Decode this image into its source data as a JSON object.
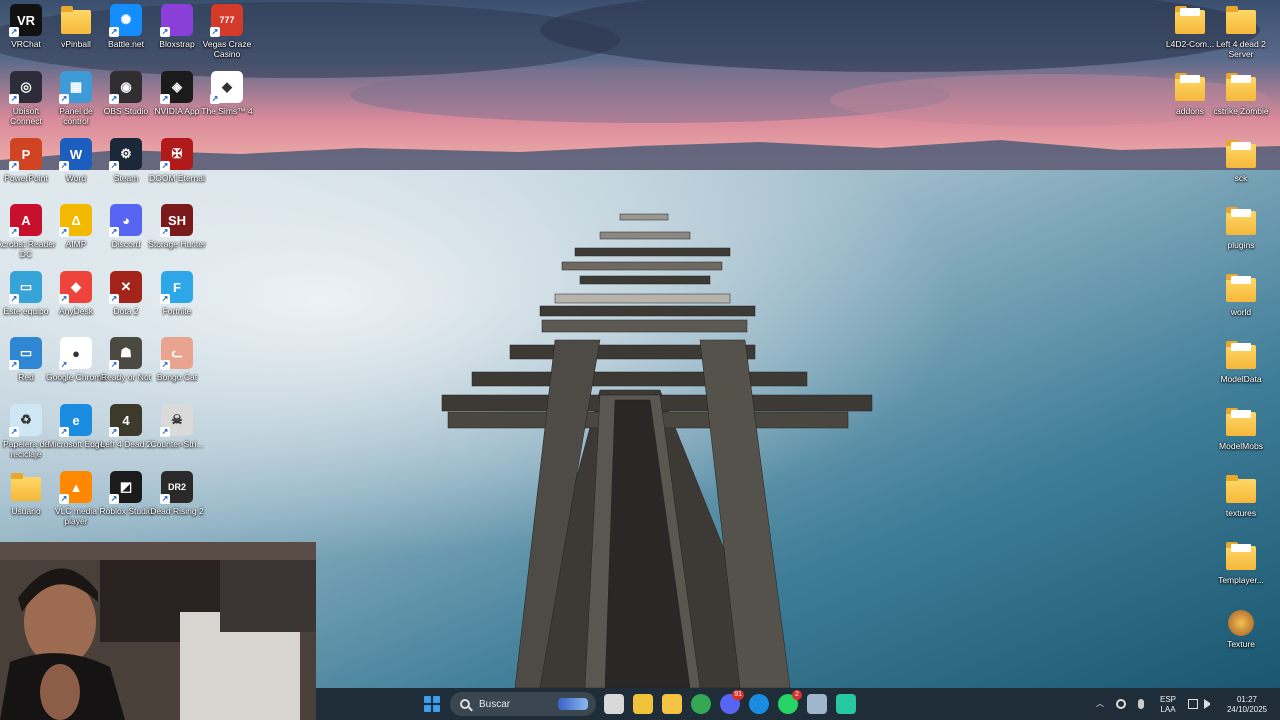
{
  "desktop": {
    "left_icons": [
      {
        "label": "VRChat",
        "icon": "vrchat-icon",
        "color": "#111111",
        "glyph": "VR"
      },
      {
        "label": "vPinball",
        "icon": "folder-icon",
        "color": "#f5c445",
        "glyph": ""
      },
      {
        "label": "Battle.net",
        "icon": "battlenet-icon",
        "color": "#148eff",
        "glyph": "✺"
      },
      {
        "label": "Bloxstrap",
        "icon": "bloxstrap-icon",
        "color": "#8b3fd9",
        "glyph": ""
      },
      {
        "label": "Vegas Craze Casino",
        "icon": "vegas-craze-icon",
        "color": "#d43a2a",
        "glyph": "777"
      },
      {
        "label": "Ubisoft Connect",
        "icon": "ubisoft-icon",
        "color": "#2c2c3a",
        "glyph": "◎"
      },
      {
        "label": "Panel de control",
        "icon": "control-panel-icon",
        "color": "#3f9ad8",
        "glyph": "▦"
      },
      {
        "label": "OBS Studio",
        "icon": "obs-icon",
        "color": "#302e31",
        "glyph": "◉"
      },
      {
        "label": "NVIDIA App",
        "icon": "nvidia-icon",
        "color": "#1b1b1b",
        "glyph": "◈"
      },
      {
        "label": "The Sims™ 4",
        "icon": "sims-icon",
        "color": "#ffffff",
        "glyph": "◆"
      },
      {
        "label": "PowerPoint",
        "icon": "powerpoint-icon",
        "color": "#d04423",
        "glyph": "P"
      },
      {
        "label": "Word",
        "icon": "word-icon",
        "color": "#1b5ebe",
        "glyph": "W"
      },
      {
        "label": "Steam",
        "icon": "steam-icon",
        "color": "#1b2838",
        "glyph": "⚙"
      },
      {
        "label": "DOOM Eternal",
        "icon": "doom-icon",
        "color": "#b01a1a",
        "glyph": "✠"
      },
      {
        "label": "Acrobat Reader DC",
        "icon": "acrobat-icon",
        "color": "#c8102e",
        "glyph": "A"
      },
      {
        "label": "AIMP",
        "icon": "aimp-icon",
        "color": "#f2b900",
        "glyph": "Δ"
      },
      {
        "label": "Discord",
        "icon": "discord-icon",
        "color": "#5865f2",
        "glyph": "◕"
      },
      {
        "label": "Storage Hunter",
        "icon": "storage-hunter-icon",
        "color": "#7a1a1a",
        "glyph": "SH"
      },
      {
        "label": "Este equipo",
        "icon": "this-pc-icon",
        "color": "#36a3d9",
        "glyph": "▭"
      },
      {
        "label": "AnyDesk",
        "icon": "anydesk-icon",
        "color": "#ef443b",
        "glyph": "◆"
      },
      {
        "label": "Dota 2",
        "icon": "dota2-icon",
        "color": "#a3241b",
        "glyph": "✕"
      },
      {
        "label": "Fortnite",
        "icon": "fortnite-icon",
        "color": "#2ea7e8",
        "glyph": "F"
      },
      {
        "label": "Red",
        "icon": "network-icon",
        "color": "#2f86d2",
        "glyph": "▭"
      },
      {
        "label": "Google Chrome",
        "icon": "chrome-icon",
        "color": "#ffffff",
        "glyph": "●"
      },
      {
        "label": "Ready or Not",
        "icon": "ready-or-not-icon",
        "color": "#4a4a42",
        "glyph": "☗"
      },
      {
        "label": "Bongo Cat",
        "icon": "bongo-cat-icon",
        "color": "#e9a48f",
        "glyph": "ᓚ"
      },
      {
        "label": "Papelera de reciclaje",
        "icon": "recycle-bin-icon",
        "color": "#cfe7f5",
        "glyph": "♻"
      },
      {
        "label": "Microsoft Edge",
        "icon": "edge-icon",
        "color": "#1a8de0",
        "glyph": "e"
      },
      {
        "label": "Left 4 Dead 2",
        "icon": "left4dead2-icon",
        "color": "#3b3a2b",
        "glyph": "4"
      },
      {
        "label": "Counter-Stri...",
        "icon": "counter-strike-icon",
        "color": "#dadada",
        "glyph": "☠"
      },
      {
        "label": "Usuario",
        "icon": "folder-icon",
        "color": "#f5c445",
        "glyph": ""
      },
      {
        "label": "VLC media player",
        "icon": "vlc-icon",
        "color": "#ff8800",
        "glyph": "▲"
      },
      {
        "label": "Roblox Studio",
        "icon": "roblox-studio-icon",
        "color": "#1b1b1b",
        "glyph": "◩"
      },
      {
        "label": "Dead Rising 2",
        "icon": "dead-rising2-icon",
        "color": "#2a2a2a",
        "glyph": "DR2"
      }
    ],
    "right_icons": [
      {
        "label": "L4D2-Com...",
        "icon": "folder-icon"
      },
      {
        "label": "Left 4 dead 2 Server",
        "icon": "folder-icon"
      },
      {
        "label": "addons",
        "icon": "folder-icon"
      },
      {
        "label": "cstrike Zombie",
        "icon": "folder-icon"
      },
      {
        "label": "sck",
        "icon": "folder-icon"
      },
      {
        "label": "plugins",
        "icon": "folder-icon"
      },
      {
        "label": "world",
        "icon": "folder-icon"
      },
      {
        "label": "ModelData",
        "icon": "folder-icon"
      },
      {
        "label": "ModelMobs",
        "icon": "folder-icon"
      },
      {
        "label": "textures",
        "icon": "folder-icon"
      },
      {
        "label": "Templayer...",
        "icon": "folder-icon"
      },
      {
        "label": "Texture",
        "icon": "texture-file-icon"
      }
    ]
  },
  "taskbar": {
    "search_placeholder": "Buscar",
    "apps": [
      {
        "name": "task-view",
        "color": "#d9d9d9",
        "badge": ""
      },
      {
        "name": "microsoft-store",
        "color": "#f0c23a",
        "badge": ""
      },
      {
        "name": "file-explorer",
        "color": "#f5c445",
        "badge": ""
      },
      {
        "name": "chrome",
        "color": "#34a853",
        "badge": ""
      },
      {
        "name": "discord",
        "color": "#5865f2",
        "badge": "91"
      },
      {
        "name": "edge",
        "color": "#1a8de0",
        "badge": ""
      },
      {
        "name": "whatsapp",
        "color": "#25d366",
        "badge": "2"
      },
      {
        "name": "steam",
        "color": "#9fb7cc",
        "badge": ""
      },
      {
        "name": "app",
        "color": "#27c8a0",
        "badge": ""
      }
    ],
    "tray": {
      "lang_top": "ESP",
      "lang_bottom": "LAA",
      "time": "01:27",
      "date": "24/10/2025"
    }
  }
}
